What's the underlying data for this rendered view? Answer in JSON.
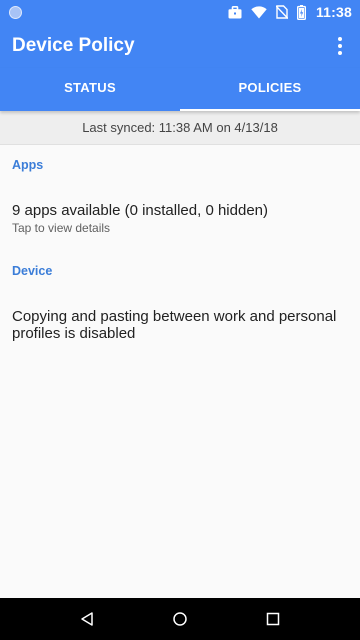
{
  "status_bar": {
    "time": "11:38"
  },
  "app_bar": {
    "title": "Device Policy"
  },
  "tabs": [
    {
      "label": "STATUS",
      "active": false
    },
    {
      "label": "POLICIES",
      "active": true
    }
  ],
  "sync_banner": {
    "text": "Last synced: 11:38 AM on 4/13/18"
  },
  "sections": {
    "apps": {
      "header": "Apps",
      "primary": "9 apps available (0 installed, 0 hidden)",
      "secondary": "Tap to view details"
    },
    "device": {
      "header": "Device",
      "primary": "Copying and pasting between work and personal profiles is disabled"
    }
  },
  "colors": {
    "primary": "#4285f4",
    "accent_text": "#3b7dd8",
    "background": "#fafafa",
    "banner": "#eeeeee"
  },
  "icons": {
    "status": [
      "notification-dot-icon",
      "work-briefcase-icon",
      "wifi-icon",
      "no-sim-icon",
      "battery-icon"
    ],
    "app_bar": [
      "more-vert-icon"
    ],
    "nav": [
      "back-icon",
      "home-icon",
      "recents-icon"
    ]
  }
}
